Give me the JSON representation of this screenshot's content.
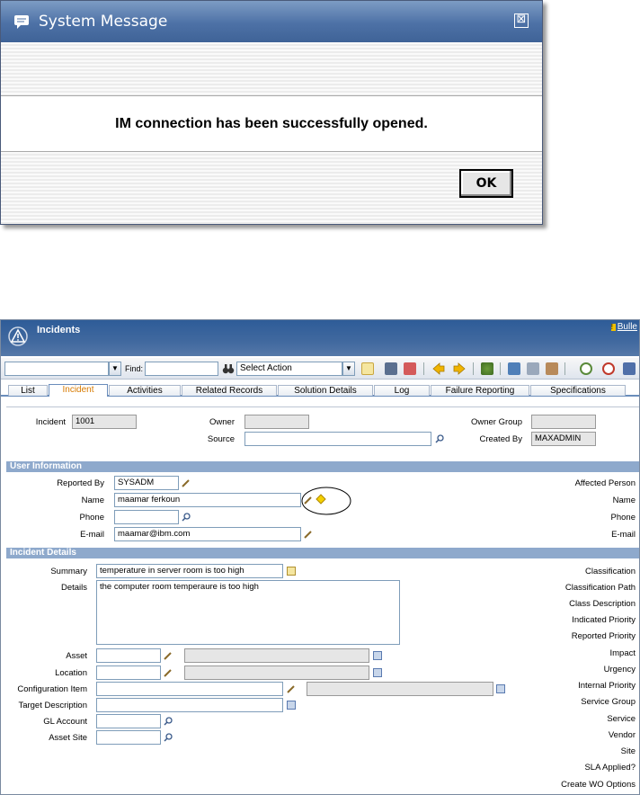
{
  "dialog": {
    "title": "System Message",
    "close_glyph": "⊠",
    "message": "IM connection has been successfully opened.",
    "ok_label": "OK"
  },
  "app": {
    "title": "Incidents",
    "bulletin": "Bulle",
    "toolbar": {
      "find_label": "Find:",
      "find_value": "",
      "query_value": "",
      "action_value": "Select Action"
    },
    "tabs": [
      "List",
      "Incident",
      "Activities",
      "Related Records",
      "Solution Details",
      "Log",
      "Failure Reporting",
      "Specifications"
    ],
    "active_tab": "Incident",
    "header_fields": {
      "incident_label": "Incident",
      "incident_value": "1001",
      "owner_label": "Owner",
      "owner_value": "",
      "source_label": "Source",
      "source_value": "",
      "owner_group_label": "Owner Group",
      "owner_group_value": "",
      "created_by_label": "Created By",
      "created_by_value": "MAXADMIN"
    },
    "user_info": {
      "section": "User Information",
      "reported_by_label": "Reported By",
      "reported_by_value": "SYSADM",
      "name_label": "Name",
      "name_value": "maamar ferkoun",
      "phone_label": "Phone",
      "phone_value": "",
      "email_label": "E-mail",
      "email_value": "maamar@ibm.com",
      "right_labels": [
        "Affected Person",
        "Name",
        "Phone",
        "E-mail"
      ]
    },
    "incident_details": {
      "section": "Incident Details",
      "summary_label": "Summary",
      "summary_value": "temperature in server room is too high",
      "details_label": "Details",
      "details_value": "the computer room temperaure is too high",
      "asset_label": "Asset",
      "location_label": "Location",
      "ci_label": "Configuration Item",
      "target_label": "Target Description",
      "gl_label": "GL Account",
      "site_label": "Asset Site",
      "right_labels": [
        "Classification",
        "Classification Path",
        "Class Description",
        "Indicated Priority",
        "Reported Priority",
        "Impact",
        "Urgency",
        "Internal Priority",
        "Service Group",
        "Service",
        "Vendor",
        "Site",
        "SLA Applied?",
        "Create WO Options"
      ]
    }
  },
  "colors": {
    "title_bar": "#4d71a6",
    "section_bar": "#8ea9cc",
    "active_tab_text": "#d77a00"
  }
}
